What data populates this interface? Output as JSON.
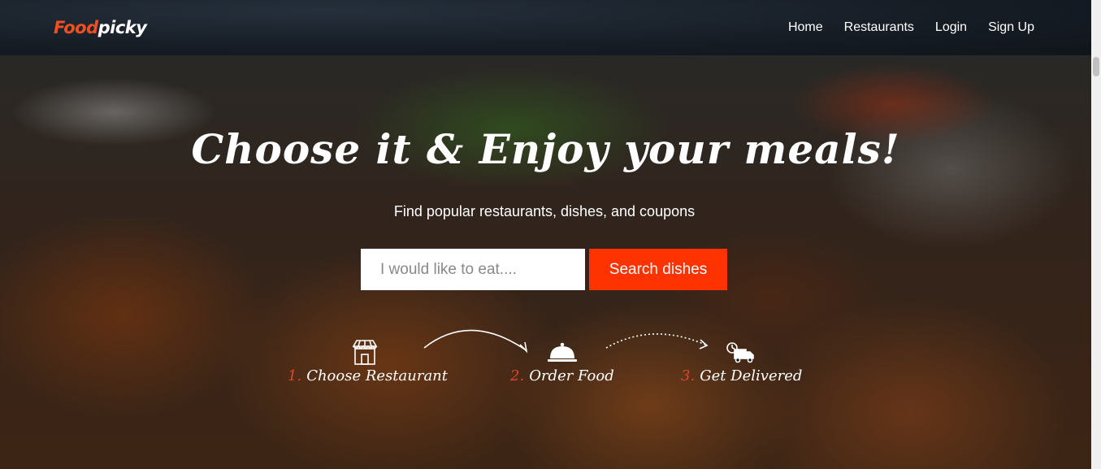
{
  "brand": {
    "logo_part1": "Food",
    "logo_part2": "picky"
  },
  "nav": {
    "items": [
      "Home",
      "Restaurants",
      "Login",
      "Sign Up"
    ]
  },
  "hero": {
    "title": "Choose it & Enjoy your meals!",
    "subtitle": "Find popular restaurants, dishes, and coupons",
    "search_placeholder": "I would like to eat....",
    "search_button": "Search dishes"
  },
  "steps": [
    {
      "num": "1.",
      "label": "Choose Restaurant",
      "icon": "store-icon"
    },
    {
      "num": "2.",
      "label": "Order Food",
      "icon": "cloche-icon"
    },
    {
      "num": "3.",
      "label": "Get Delivered",
      "icon": "delivery-truck-icon"
    }
  ],
  "colors": {
    "accent": "#ff3300",
    "logo_orange": "#f04e23",
    "step_number": "#e5432b"
  }
}
